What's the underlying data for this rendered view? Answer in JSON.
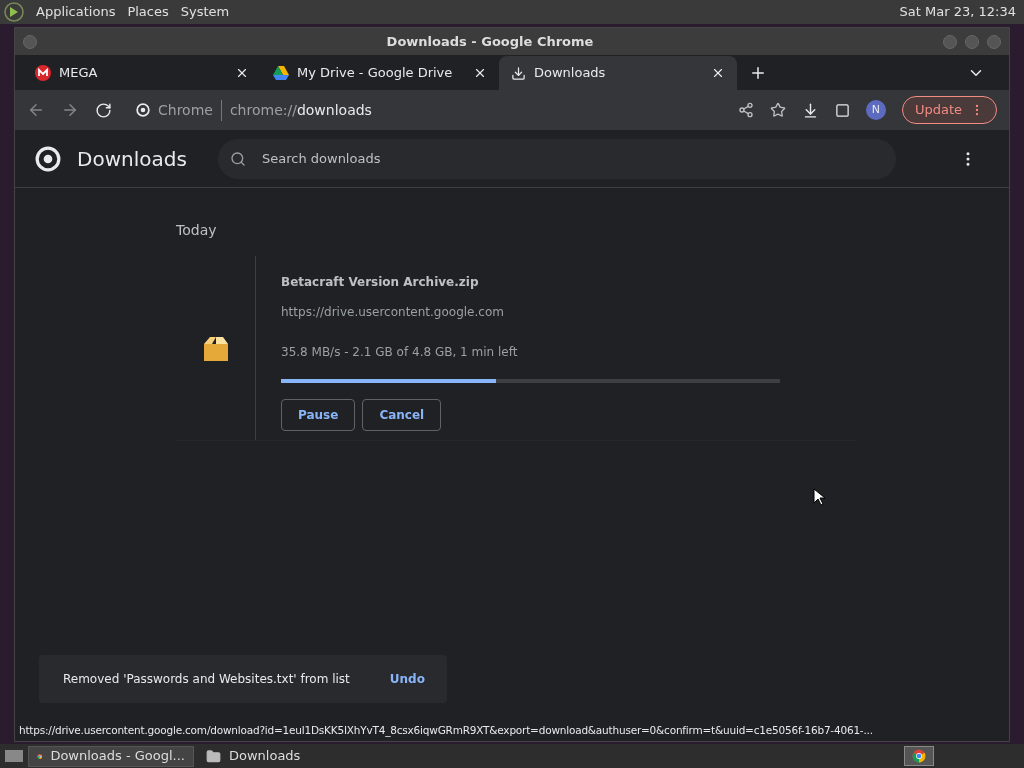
{
  "top_panel": {
    "menus": [
      "Applications",
      "Places",
      "System"
    ],
    "clock": "Sat Mar 23, 12:34"
  },
  "window": {
    "title": "Downloads - Google Chrome"
  },
  "tabs": [
    {
      "label": "MEGA",
      "kind": "mega",
      "selected": false
    },
    {
      "label": "My Drive - Google Drive",
      "kind": "drive",
      "selected": false
    },
    {
      "label": "Downloads",
      "kind": "download",
      "selected": true
    }
  ],
  "toolbar": {
    "site_label": "Chrome",
    "url_scheme": "chrome://",
    "url_path": "downloads",
    "avatar": "N",
    "update": "Update"
  },
  "page": {
    "title": "Downloads",
    "search": {
      "placeholder": "Search downloads"
    },
    "section": "Today",
    "download": {
      "filename": "Betacraft Version Archive.zip",
      "source": "https://drive.usercontent.google.com",
      "status": "35.8 MB/s - 2.1 GB of 4.8 GB, 1 min left",
      "level": 0.43,
      "buttons": [
        "Pause",
        "Cancel"
      ]
    },
    "toast": {
      "message": "Removed 'Passwords and Websites.txt' from list",
      "action": "Undo"
    }
  },
  "status_url": "https://drive.usercontent.google.com/download?id=1eul1DsKK5IXhYvT4_8csx6iqwGRmR9XT&export=download&authuser=0&confirm=t&uuid=c1e5056f-16b7-4061-...",
  "taskbar": [
    {
      "label": "Downloads - Googl...",
      "kind": "browser",
      "selected": true
    },
    {
      "label": "Downloads",
      "kind": "folder",
      "selected": false
    }
  ]
}
